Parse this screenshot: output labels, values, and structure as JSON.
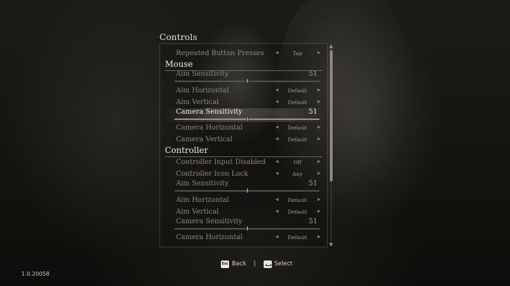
{
  "screen": {
    "title": "Controls",
    "version": "1.0.20058"
  },
  "rows": {
    "repeated": {
      "label": "Repeated Button Presses",
      "value": "Tap"
    },
    "mouse_aim_h": {
      "label": "Aim Horizontal",
      "value": "Default"
    },
    "mouse_aim_v": {
      "label": "Aim Vertical",
      "value": "Default"
    },
    "mouse_cam_h": {
      "label": "Camera Horizontal",
      "value": "Default"
    },
    "mouse_cam_v": {
      "label": "Camera Vertical",
      "value": "Default"
    },
    "ctrl_disabled": {
      "label": "Controller Input Disabled",
      "value": "Off"
    },
    "ctrl_icon_lock": {
      "label": "Controller Icon Lock",
      "value": "Any"
    },
    "ctrl_aim_h": {
      "label": "Aim Horizontal",
      "value": "Default"
    },
    "ctrl_aim_v": {
      "label": "Aim Vertical",
      "value": "Default"
    },
    "ctrl_cam_h": {
      "label": "Camera Horizontal",
      "value": "Default"
    }
  },
  "sections": {
    "mouse": "Mouse",
    "controller": "Controller"
  },
  "sliders": {
    "mouse_aim": {
      "label": "Aim Sensitivity",
      "value": "51",
      "level": 0.5
    },
    "mouse_cam": {
      "label": "Camera Sensitivity",
      "value": "51",
      "level": 0.5
    },
    "ctrl_aim": {
      "label": "Aim Sensitivity",
      "value": "51",
      "level": 0.5
    },
    "ctrl_cam": {
      "label": "Camera Sensitivity",
      "value": "51",
      "level": 0.5
    }
  },
  "footer": {
    "back_key": "Esc",
    "back_label": "Back",
    "separator": "|",
    "select_label": "Select"
  },
  "arrows": {
    "left": "◀",
    "right": "▶",
    "up": "▲",
    "down": "▼"
  },
  "colors": {
    "selected_text": "#f4f1e8",
    "dim_text": "#8d897f"
  }
}
